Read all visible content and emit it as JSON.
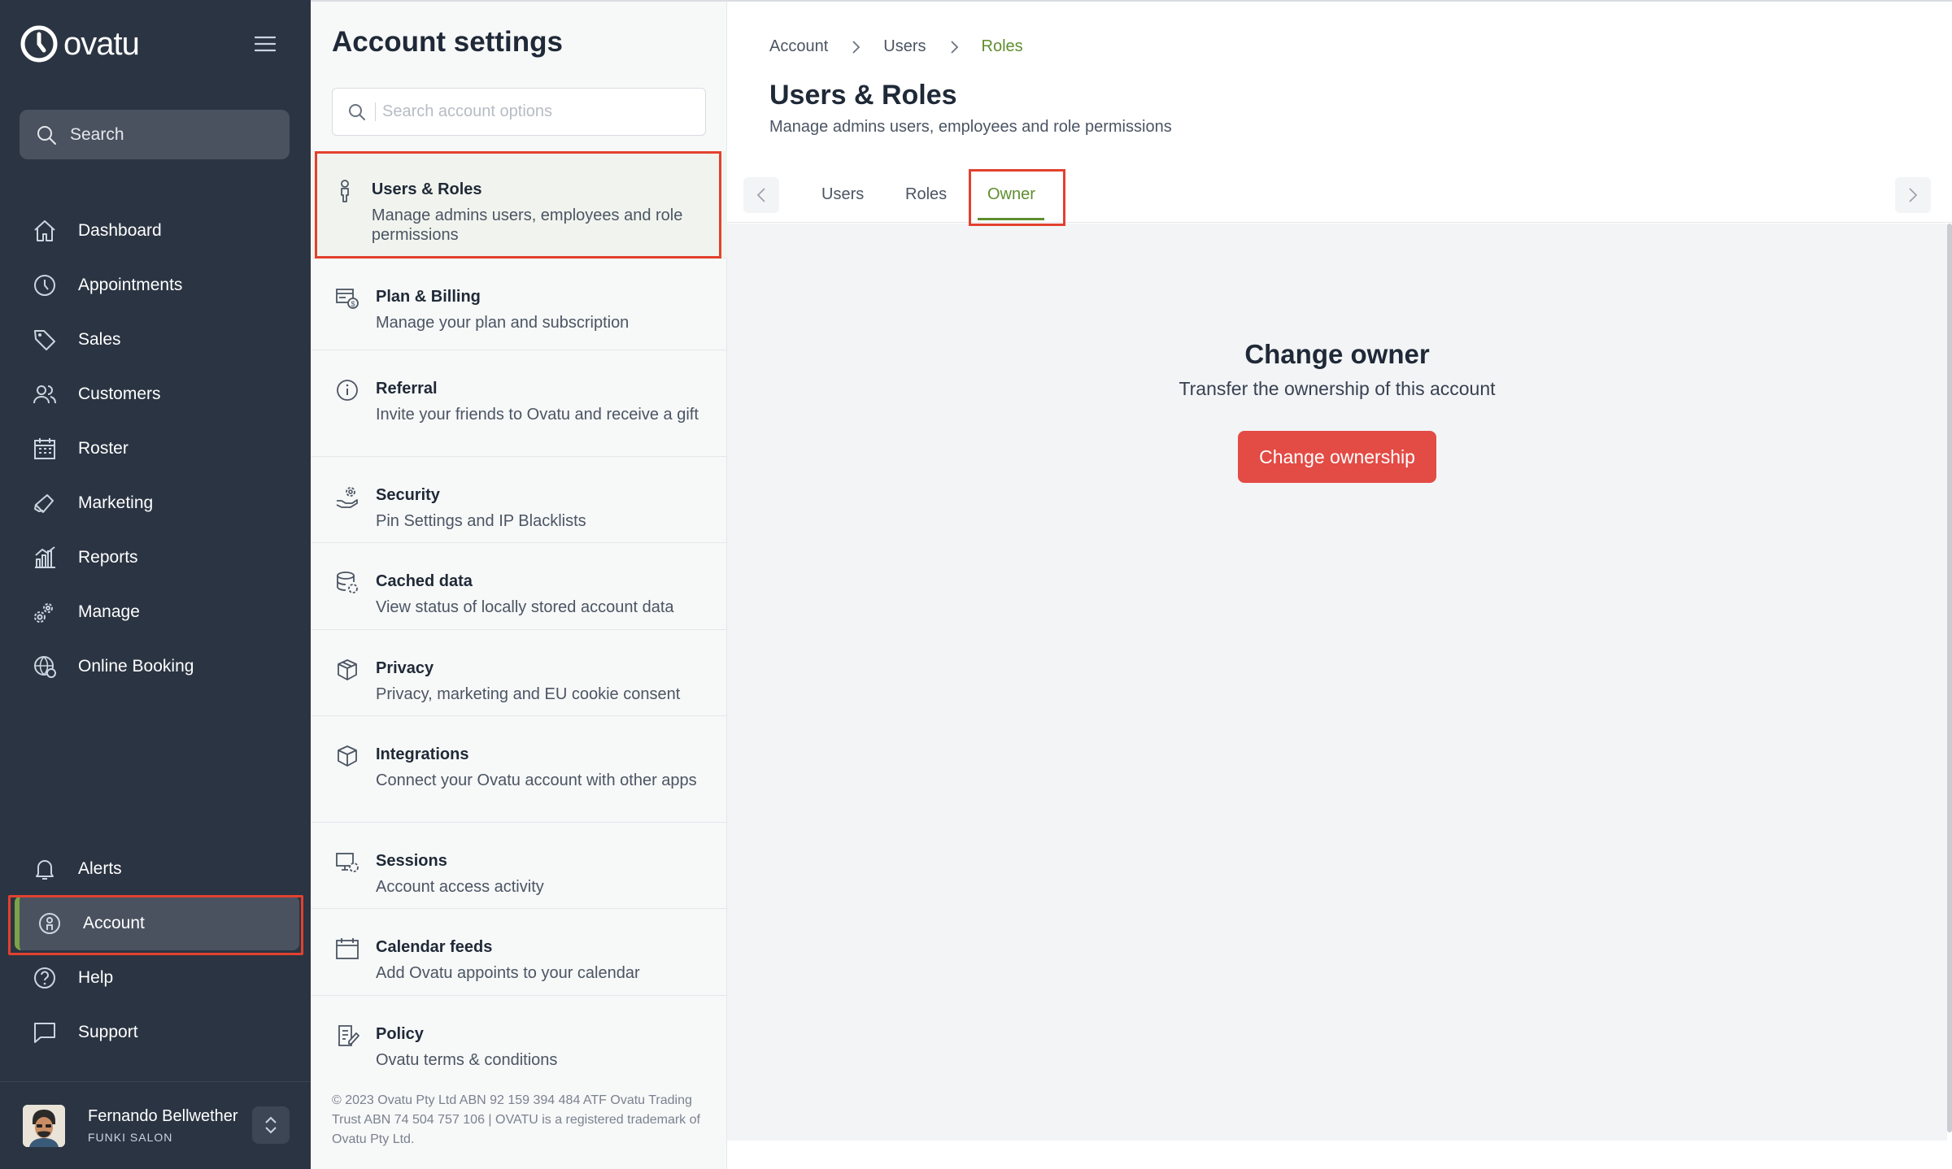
{
  "brand": {
    "name": "ovatu",
    "accent": "#7aa346",
    "danger": "#e34b45",
    "highlight": "#e2412f"
  },
  "sidebar": {
    "search_label": "Search",
    "items": [
      {
        "label": "Dashboard",
        "icon": "home-icon"
      },
      {
        "label": "Appointments",
        "icon": "clock-icon"
      },
      {
        "label": "Sales",
        "icon": "tag-icon"
      },
      {
        "label": "Customers",
        "icon": "users-icon"
      },
      {
        "label": "Roster",
        "icon": "calendar-grid-icon"
      },
      {
        "label": "Marketing",
        "icon": "megaphone-icon"
      },
      {
        "label": "Reports",
        "icon": "bar-chart-icon"
      },
      {
        "label": "Manage",
        "icon": "gears-icon"
      },
      {
        "label": "Online Booking",
        "icon": "globe-gear-icon"
      }
    ],
    "bottom_items": [
      {
        "label": "Alerts",
        "icon": "bell-icon"
      },
      {
        "label": "Account",
        "icon": "account-icon"
      },
      {
        "label": "Help",
        "icon": "help-icon"
      },
      {
        "label": "Support",
        "icon": "chat-icon"
      }
    ],
    "user": {
      "name": "Fernando Bellwether",
      "org": "FUNKI SALON"
    }
  },
  "settings": {
    "title": "Account settings",
    "search_placeholder": "Search account options",
    "options": [
      {
        "title": "Users & Roles",
        "desc": "Manage admins users, employees and role permissions",
        "icon": "person-icon"
      },
      {
        "title": "Plan & Billing",
        "desc": "Manage your plan and subscription",
        "icon": "billing-icon"
      },
      {
        "title": "Referral",
        "desc": "Invite your friends to Ovatu and receive a gift",
        "icon": "info-icon"
      },
      {
        "title": "Security",
        "desc": "Pin Settings and IP Blacklists",
        "icon": "security-gear-icon"
      },
      {
        "title": "Cached data",
        "desc": "View status of locally stored account data",
        "icon": "database-icon"
      },
      {
        "title": "Privacy",
        "desc": "Privacy, marketing and EU cookie consent",
        "icon": "box-icon"
      },
      {
        "title": "Integrations",
        "desc": "Connect your Ovatu account with other apps",
        "icon": "package-icon"
      },
      {
        "title": "Sessions",
        "desc": "Account access activity",
        "icon": "session-gear-icon"
      },
      {
        "title": "Calendar feeds",
        "desc": "Add Ovatu appoints to your calendar",
        "icon": "calendar-icon"
      },
      {
        "title": "Policy",
        "desc": "Ovatu terms & conditions",
        "icon": "policy-icon"
      }
    ],
    "footer": "© 2023 Ovatu Pty Ltd ABN 92 159 394 484 ATF Ovatu Trading Trust ABN 74 504 757 106 | OVATU is a registered trademark of Ovatu Pty Ltd."
  },
  "main": {
    "breadcrumb": [
      "Account",
      "Users",
      "Roles"
    ],
    "title": "Users & Roles",
    "subtitle": "Manage admins users, employees and role permissions",
    "tabs": [
      "Users",
      "Roles",
      "Owner"
    ],
    "owner": {
      "title": "Change owner",
      "subtitle": "Transfer the ownership of this account",
      "button": "Change ownership"
    }
  }
}
